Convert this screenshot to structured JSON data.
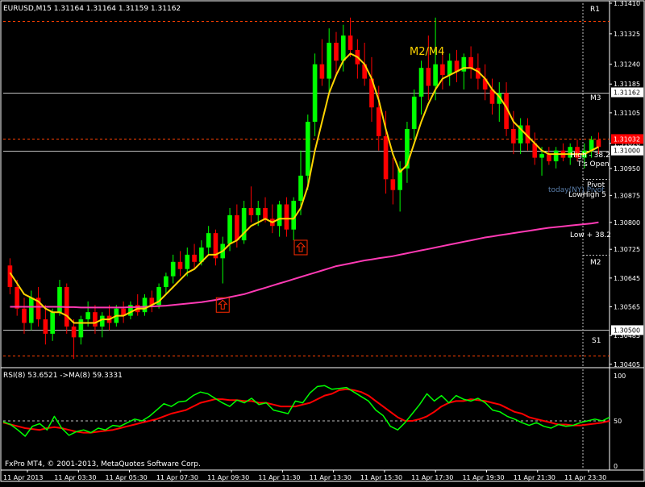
{
  "colors": {
    "background": "#000000",
    "frame": "#ffffff",
    "candle_up": "#00ff00",
    "candle_down": "#ff0000",
    "ma_fast": "#ffd400",
    "ma_slow": "#ff3ab4",
    "rsi_line": "#00ff00",
    "rsi_ma": "#ff0000",
    "level_dashed": "#ff4000",
    "level_solid": "#c0c0c0",
    "vline": "#c0c0c0",
    "annotation_white": "#ffffff",
    "annotation_blue": "#5a7eaa",
    "m2m4_label": "#ffd400",
    "marker": "#ff2a00"
  },
  "chart_data": [
    {
      "type": "candlestick",
      "header": "EURUSD,M15  1.31164 1.31164 1.31159 1.31162",
      "ylim": [
        1.304,
        1.3141
      ],
      "price_ticks": [
        "1.31410",
        "1.31325",
        "1.31240",
        "1.31185",
        "1.31105",
        "1.31020",
        "1.30950",
        "1.30875",
        "1.30800",
        "1.30725",
        "1.30645",
        "1.30565",
        "1.30485",
        "1.30405"
      ],
      "price_boxes": [
        {
          "value": "1.31162",
          "price": 1.31162,
          "fill": "#ffffff",
          "text_color": "#000000"
        },
        {
          "value": "1.31032",
          "price": 1.31032,
          "fill": "#ff0000",
          "text_color": "#ffffff"
        },
        {
          "value": "1.31000",
          "price": 1.31,
          "fill": "#ffffff",
          "text_color": "#000000"
        },
        {
          "value": "1.30500",
          "price": 1.305,
          "fill": "#ffffff",
          "text_color": "#000000"
        }
      ],
      "x_labels": [
        "11 Apr 2013",
        "11 Apr 03:30",
        "11 Apr 05:30",
        "11 Apr 07:30",
        "11 Apr 09:30",
        "11 Apr 11:30",
        "11 Apr 13:30",
        "11 Apr 15:30",
        "11 Apr 17:30",
        "11 Apr 19:30",
        "11 Apr 21:30",
        "11 Apr 23:30"
      ],
      "levels": [
        {
          "name": "R1",
          "price": 1.3136,
          "style": "dashed"
        },
        {
          "name": "M3",
          "price": 1.3116,
          "style": "solid"
        },
        {
          "name": "Pivot-dashed",
          "price": 1.31032,
          "style": "dashed"
        },
        {
          "name": "Pivot",
          "price": 1.31,
          "style": "solid"
        },
        {
          "name": "M2",
          "price": 1.3071,
          "style": "none"
        },
        {
          "name": "S1",
          "price": 1.305,
          "style": "solid"
        },
        {
          "name": "bottom",
          "price": 1.3043,
          "style": "dashed"
        }
      ],
      "level_labels": [
        "R1",
        "M3",
        "M2",
        "S1"
      ],
      "annotations": {
        "high_label": "High - 38.2",
        "ts_open": "T's Open",
        "pivot": "Pivot",
        "today_ny": "today(NY) Pivot",
        "low_high": "LowHigh 5",
        "low_38": "Low + 38.2",
        "m2m4": "M2/M4"
      },
      "ma_fast_name": "",
      "ma_slow_name": "",
      "candles": [
        [
          1.3068,
          1.307,
          1.306,
          1.3062
        ],
        [
          1.3062,
          1.3064,
          1.3054,
          1.3056
        ],
        [
          1.3056,
          1.3059,
          1.3049,
          1.3052
        ],
        [
          1.3052,
          1.3061,
          1.305,
          1.3059
        ],
        [
          1.3059,
          1.3062,
          1.3051,
          1.3053
        ],
        [
          1.3053,
          1.3057,
          1.3046,
          1.3049
        ],
        [
          1.3049,
          1.3056,
          1.3047,
          1.3055
        ],
        [
          1.3055,
          1.3064,
          1.3054,
          1.3062
        ],
        [
          1.3062,
          1.3063,
          1.3049,
          1.3051
        ],
        [
          1.3051,
          1.3053,
          1.3042,
          1.3048
        ],
        [
          1.3048,
          1.3054,
          1.3046,
          1.3053
        ],
        [
          1.3053,
          1.3058,
          1.3051,
          1.3055
        ],
        [
          1.3055,
          1.3057,
          1.3049,
          1.3051
        ],
        [
          1.3051,
          1.3055,
          1.3048,
          1.3054
        ],
        [
          1.3054,
          1.3057,
          1.305,
          1.3052
        ],
        [
          1.3052,
          1.3057,
          1.3051,
          1.3056
        ],
        [
          1.3056,
          1.3058,
          1.3052,
          1.3054
        ],
        [
          1.3054,
          1.3058,
          1.3053,
          1.3057
        ],
        [
          1.3057,
          1.306,
          1.3054,
          1.3055
        ],
        [
          1.3055,
          1.306,
          1.3054,
          1.3059
        ],
        [
          1.3059,
          1.3061,
          1.3055,
          1.3057
        ],
        [
          1.3057,
          1.3063,
          1.3056,
          1.3062
        ],
        [
          1.3062,
          1.3066,
          1.306,
          1.3065
        ],
        [
          1.3065,
          1.3071,
          1.3063,
          1.3069
        ],
        [
          1.3069,
          1.3072,
          1.3065,
          1.3067
        ],
        [
          1.3067,
          1.3073,
          1.3065,
          1.3071
        ],
        [
          1.3071,
          1.3074,
          1.3067,
          1.3069
        ],
        [
          1.3069,
          1.3075,
          1.3068,
          1.3073
        ],
        [
          1.3073,
          1.3079,
          1.3071,
          1.3077
        ],
        [
          1.3077,
          1.3078,
          1.3068,
          1.307
        ],
        [
          1.307,
          1.3076,
          1.3063,
          1.3074
        ],
        [
          1.3074,
          1.3084,
          1.3072,
          1.3082
        ],
        [
          1.3082,
          1.3085,
          1.3073,
          1.3075
        ],
        [
          1.3075,
          1.3086,
          1.3074,
          1.3084
        ],
        [
          1.3084,
          1.309,
          1.308,
          1.3082
        ],
        [
          1.3082,
          1.3086,
          1.3079,
          1.3084
        ],
        [
          1.3084,
          1.3087,
          1.308,
          1.3081
        ],
        [
          1.3081,
          1.3085,
          1.3077,
          1.3079
        ],
        [
          1.3079,
          1.3086,
          1.3076,
          1.3085
        ],
        [
          1.3085,
          1.3087,
          1.3076,
          1.3078
        ],
        [
          1.3078,
          1.3087,
          1.3075,
          1.3086
        ],
        [
          1.3086,
          1.31,
          1.3082,
          1.3093
        ],
        [
          1.3093,
          1.311,
          1.3089,
          1.3108
        ],
        [
          1.3108,
          1.3127,
          1.3104,
          1.3124
        ],
        [
          1.3124,
          1.3131,
          1.3118,
          1.312
        ],
        [
          1.312,
          1.3134,
          1.3116,
          1.313
        ],
        [
          1.313,
          1.3133,
          1.3121,
          1.3125
        ],
        [
          1.3125,
          1.3135,
          1.3122,
          1.3132
        ],
        [
          1.3132,
          1.3137,
          1.3126,
          1.3128
        ],
        [
          1.3128,
          1.3131,
          1.312,
          1.3124
        ],
        [
          1.3124,
          1.313,
          1.3118,
          1.312
        ],
        [
          1.312,
          1.3126,
          1.3108,
          1.3112
        ],
        [
          1.3112,
          1.3118,
          1.31,
          1.3104
        ],
        [
          1.3104,
          1.3111,
          1.3088,
          1.3092
        ],
        [
          1.3092,
          1.3098,
          1.3085,
          1.3089
        ],
        [
          1.3089,
          1.3097,
          1.3083,
          1.3095
        ],
        [
          1.3095,
          1.3108,
          1.3091,
          1.3106
        ],
        [
          1.3106,
          1.3117,
          1.3103,
          1.3115
        ],
        [
          1.3115,
          1.3125,
          1.311,
          1.3123
        ],
        [
          1.3123,
          1.3132,
          1.3114,
          1.3118
        ],
        [
          1.3118,
          1.3137,
          1.3114,
          1.3124
        ],
        [
          1.3124,
          1.3128,
          1.3117,
          1.3121
        ],
        [
          1.3121,
          1.3127,
          1.3118,
          1.3125
        ],
        [
          1.3125,
          1.3128,
          1.3119,
          1.3122
        ],
        [
          1.3122,
          1.3127,
          1.3117,
          1.3126
        ],
        [
          1.3126,
          1.3129,
          1.312,
          1.3123
        ],
        [
          1.3123,
          1.3127,
          1.3117,
          1.312
        ],
        [
          1.312,
          1.3124,
          1.3114,
          1.3117
        ],
        [
          1.3117,
          1.312,
          1.311,
          1.3113
        ],
        [
          1.3113,
          1.3119,
          1.3108,
          1.3116
        ],
        [
          1.3116,
          1.3119,
          1.3104,
          1.3106
        ],
        [
          1.3106,
          1.3111,
          1.3099,
          1.3102
        ],
        [
          1.3102,
          1.3109,
          1.3099,
          1.3107
        ],
        [
          1.3107,
          1.3109,
          1.31,
          1.3102
        ],
        [
          1.3102,
          1.3105,
          1.3096,
          1.3098
        ],
        [
          1.3098,
          1.3101,
          1.3093,
          1.3099
        ],
        [
          1.3099,
          1.3101,
          1.3096,
          1.3097
        ],
        [
          1.3097,
          1.3101,
          1.3095,
          1.31
        ],
        [
          1.31,
          1.3102,
          1.3097,
          1.3098
        ],
        [
          1.3098,
          1.3102,
          1.3096,
          1.3101
        ],
        [
          1.3101,
          1.3103,
          1.3097,
          1.3098
        ],
        [
          1.3098,
          1.3102,
          1.3095,
          1.31
        ],
        [
          1.31,
          1.3104,
          1.3098,
          1.3103
        ],
        [
          1.3103,
          1.3105,
          1.3099,
          1.3101
        ]
      ],
      "ma_fast": [
        1.3066,
        1.3063,
        1.306,
        1.3059,
        1.3058,
        1.3056,
        1.3055,
        1.3055,
        1.3054,
        1.3052,
        1.3052,
        1.3052,
        1.3052,
        1.3053,
        1.3053,
        1.3054,
        1.3054,
        1.3055,
        1.3056,
        1.3056,
        1.3057,
        1.3058,
        1.306,
        1.3062,
        1.3064,
        1.3066,
        1.3067,
        1.3069,
        1.3071,
        1.3071,
        1.3072,
        1.3074,
        1.3075,
        1.3077,
        1.3079,
        1.308,
        1.3081,
        1.308,
        1.3081,
        1.3081,
        1.3081,
        1.3084,
        1.309,
        1.31,
        1.3108,
        1.3116,
        1.3121,
        1.3125,
        1.3127,
        1.3126,
        1.3124,
        1.312,
        1.3114,
        1.3106,
        1.3099,
        1.3094,
        1.3096,
        1.3102,
        1.3108,
        1.3113,
        1.3117,
        1.312,
        1.3121,
        1.3122,
        1.3123,
        1.3123,
        1.3122,
        1.312,
        1.3117,
        1.3115,
        1.3112,
        1.3108,
        1.3106,
        1.3104,
        1.3102,
        1.31,
        1.3099,
        1.3099,
        1.3099,
        1.3099,
        1.3099,
        1.3099,
        1.31,
        1.3101
      ],
      "ma_slow": [
        1.30565,
        1.30565,
        1.30565,
        1.30565,
        1.30565,
        1.30565,
        1.30565,
        1.30565,
        1.30564,
        1.30564,
        1.30563,
        1.30563,
        1.30563,
        1.30563,
        1.30563,
        1.30563,
        1.30563,
        1.30564,
        1.30564,
        1.30565,
        1.30566,
        1.30567,
        1.30568,
        1.3057,
        1.30572,
        1.30574,
        1.30576,
        1.30578,
        1.30581,
        1.30584,
        1.30588,
        1.30592,
        1.30596,
        1.306,
        1.30606,
        1.30612,
        1.30618,
        1.30624,
        1.3063,
        1.30636,
        1.30642,
        1.30648,
        1.30654,
        1.3066,
        1.30666,
        1.30672,
        1.30678,
        1.30682,
        1.30686,
        1.3069,
        1.30694,
        1.30697,
        1.307,
        1.30703,
        1.30706,
        1.3071,
        1.30714,
        1.30718,
        1.30722,
        1.30726,
        1.3073,
        1.30734,
        1.30738,
        1.30742,
        1.30746,
        1.3075,
        1.30754,
        1.30758,
        1.30761,
        1.30764,
        1.30767,
        1.3077,
        1.30773,
        1.30776,
        1.30779,
        1.30782,
        1.30785,
        1.30787,
        1.30789,
        1.30791,
        1.30793,
        1.30795,
        1.30797,
        1.308
      ],
      "arrows": [
        [
          30,
          1.3057
        ],
        [
          41,
          1.3073
        ]
      ]
    },
    {
      "type": "line",
      "title": "RSI(8) 53.6521  ->MA(8) 59.3331",
      "footer": "FxPro MT4, © 2001-2013, MetaQuotes Software Corp.",
      "ylim": [
        0,
        100
      ],
      "y_ticks": [
        "100",
        "50",
        "0"
      ],
      "level": 50,
      "series": [
        {
          "name": "RSI(8)",
          "values": [
            49,
            46,
            40,
            33,
            44,
            47,
            40,
            55,
            42,
            34,
            38,
            40,
            37,
            42,
            40,
            45,
            44,
            48,
            52,
            50,
            55,
            62,
            69,
            66,
            71,
            72,
            78,
            82,
            80,
            75,
            70,
            66,
            73,
            70,
            75,
            68,
            70,
            62,
            60,
            58,
            72,
            70,
            81,
            88,
            89,
            85,
            86,
            87,
            82,
            77,
            72,
            62,
            56,
            44,
            40,
            48,
            58,
            68,
            80,
            72,
            78,
            70,
            78,
            74,
            72,
            75,
            70,
            62,
            60,
            55,
            52,
            48,
            45,
            48,
            44,
            42,
            46,
            44,
            45,
            48,
            50,
            52,
            50,
            54
          ]
        },
        {
          "name": "->MA(8)",
          "values": [
            48,
            46,
            44,
            42,
            41,
            40,
            42,
            43,
            42,
            40,
            38,
            37,
            37,
            38,
            39,
            40,
            42,
            44,
            46,
            48,
            50,
            52,
            55,
            58,
            60,
            62,
            66,
            70,
            72,
            74,
            74,
            73,
            73,
            72,
            72,
            70,
            70,
            68,
            66,
            66,
            66,
            68,
            70,
            74,
            78,
            80,
            84,
            85,
            84,
            82,
            78,
            72,
            66,
            60,
            54,
            50,
            50,
            52,
            55,
            60,
            66,
            70,
            72,
            72,
            74,
            73,
            72,
            70,
            68,
            64,
            60,
            58,
            54,
            52,
            50,
            48,
            46,
            46,
            45,
            45,
            46,
            47,
            48,
            50
          ]
        }
      ]
    }
  ]
}
